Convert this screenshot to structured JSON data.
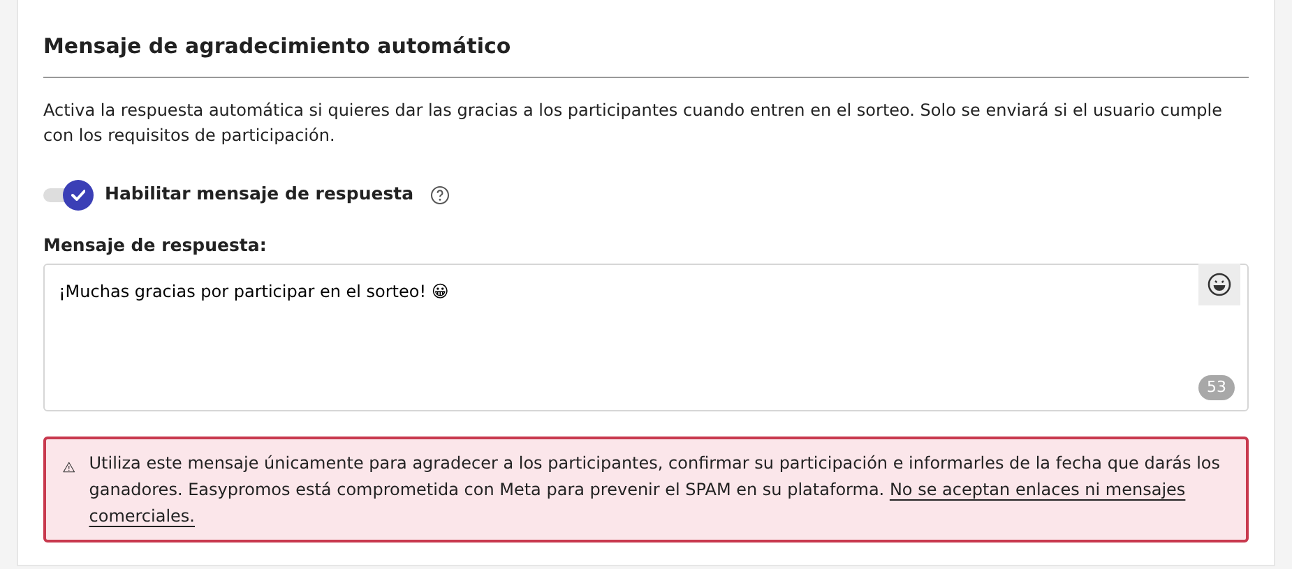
{
  "section": {
    "title": "Mensaje de agradecimiento automático",
    "description": "Activa la respuesta automática si quieres dar las gracias a los participantes cuando entren en el sorteo. Solo se enviará si el usuario cumple con los requisitos de participación.",
    "toggle": {
      "label": "Habilitar mensaje de respuesta",
      "on": true
    },
    "message_field": {
      "label": "Mensaje de respuesta:",
      "value": "¡Muchas gracias por participar en el sorteo! 😀",
      "counter": "53"
    },
    "warning": {
      "text": "Utiliza este mensaje únicamente para agradecer a los participantes, confirmar su participación e informarles de la fecha que darás los ganadores. Easypromos está comprometida con Meta para prevenir el SPAM en su plataforma. ",
      "underlined": "No se aceptan enlaces ni mensajes comerciales."
    }
  }
}
